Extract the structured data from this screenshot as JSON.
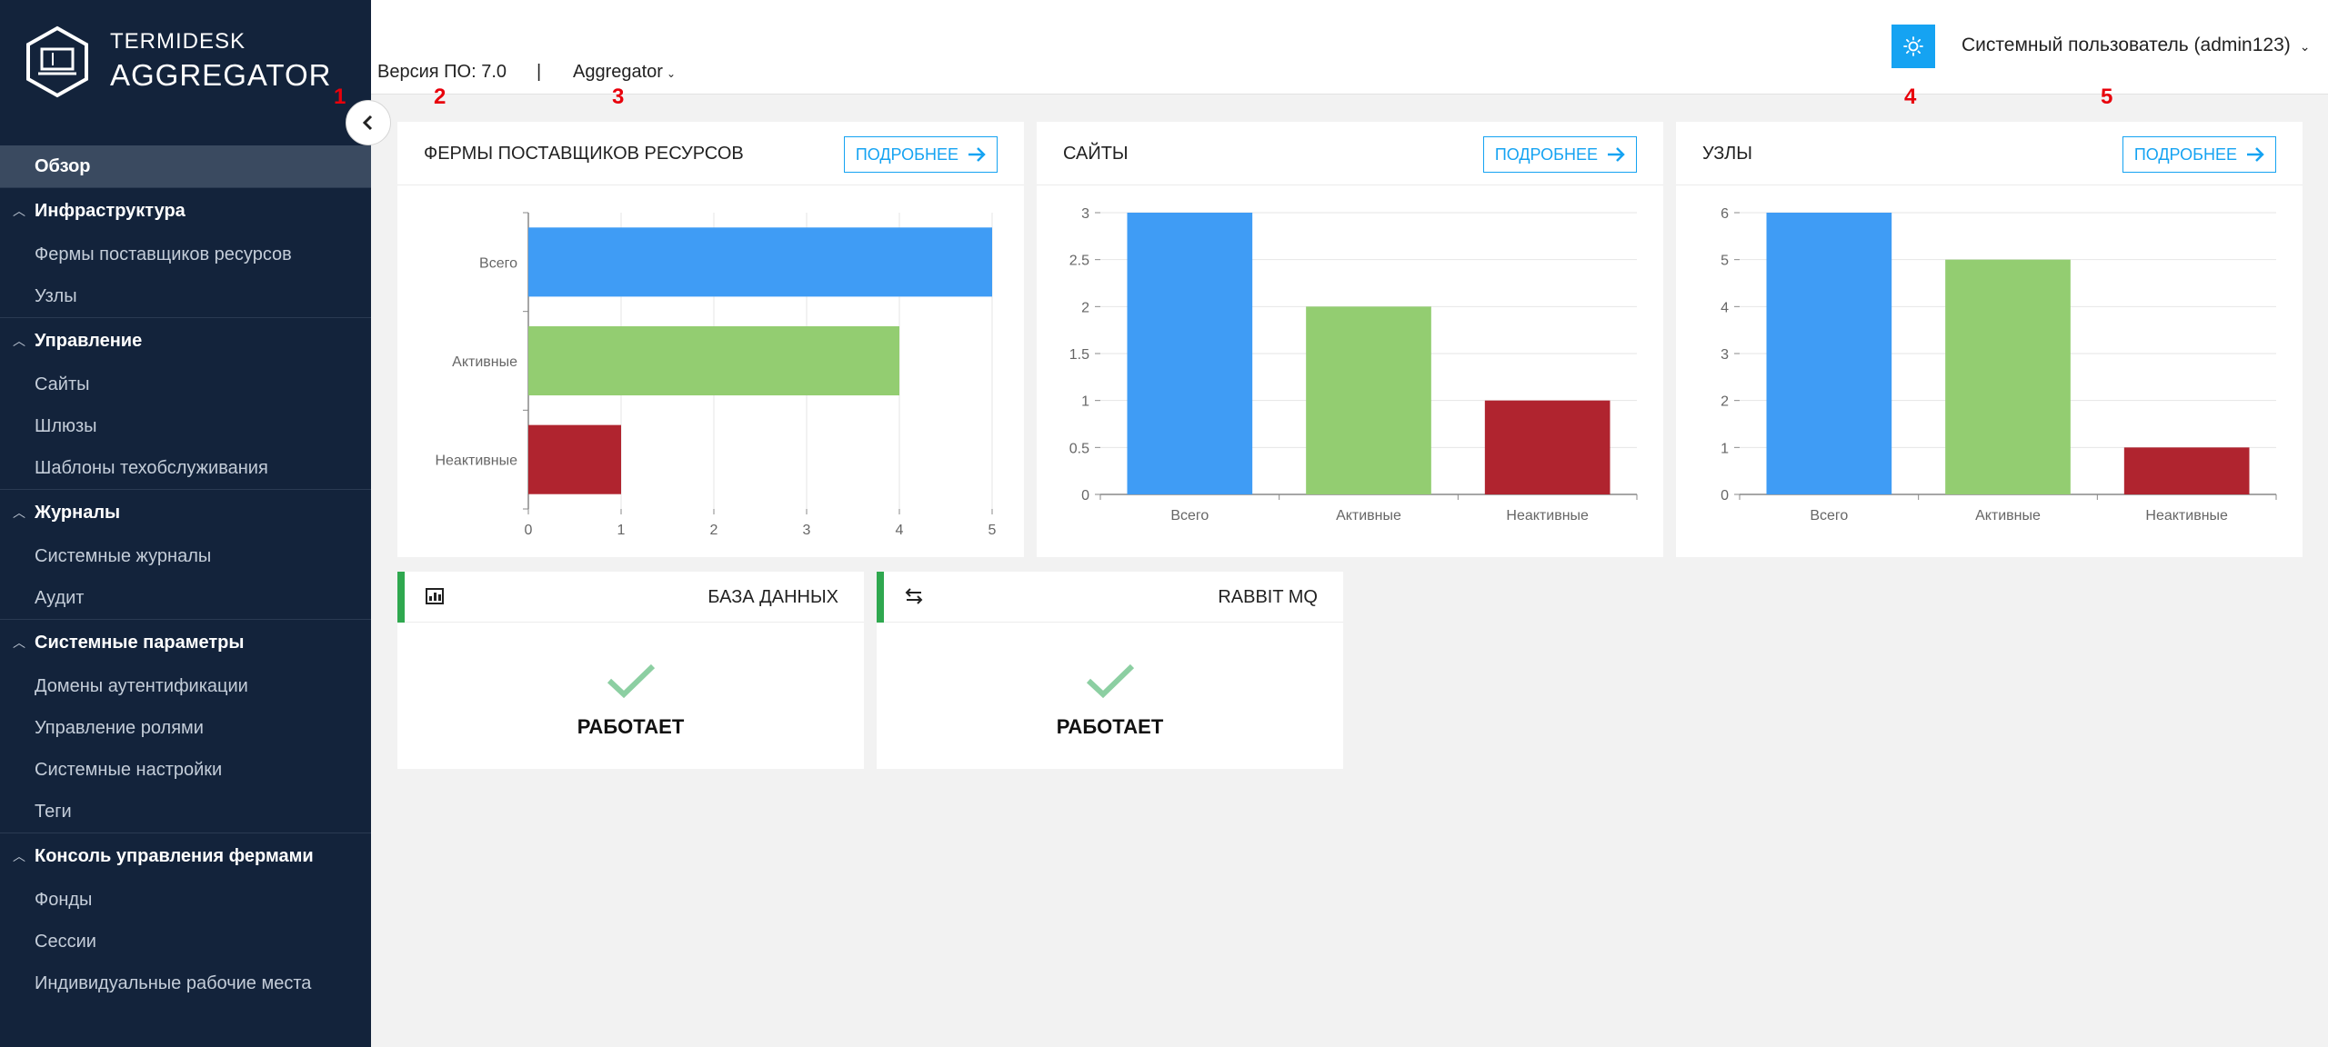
{
  "brand": {
    "top": "TERMIDESK",
    "main": "AGGREGATOR"
  },
  "sidebar": {
    "active": "Обзор",
    "groups": [
      {
        "title": "Инфраструктура",
        "items": [
          "Фермы поставщиков ресурсов",
          "Узлы"
        ]
      },
      {
        "title": "Управление",
        "items": [
          "Сайты",
          "Шлюзы",
          "Шаблоны техобслуживания"
        ]
      },
      {
        "title": "Журналы",
        "items": [
          "Системные журналы",
          "Аудит"
        ]
      },
      {
        "title": "Системные параметры",
        "items": [
          "Домены аутентификации",
          "Управление ролями",
          "Системные настройки",
          "Теги"
        ]
      },
      {
        "title": "Консоль управления фермами",
        "items": [
          "Фонды",
          "Сессии",
          "Индивидуальные рабочие места"
        ]
      }
    ]
  },
  "header": {
    "version": "Версия ПО: 7.0",
    "separator": "|",
    "context": "Aggregator",
    "user": "Системный пользователь (admin123)"
  },
  "markers": [
    "1",
    "2",
    "3",
    "4",
    "5"
  ],
  "more_label": "ПОДРОБНЕЕ",
  "colors": {
    "total": "#3f9cf5",
    "active": "#93cd71",
    "inactive": "#b0242f",
    "accent": "#15a3f2",
    "ok": "#2fa84f"
  },
  "cards": {
    "farms": {
      "title": "ФЕРМЫ ПОСТАВЩИКОВ РЕСУРСОВ"
    },
    "sites": {
      "title": "САЙТЫ"
    },
    "nodes": {
      "title": "УЗЛЫ"
    }
  },
  "chart_data": [
    {
      "type": "bar",
      "orientation": "horizontal",
      "categories": [
        "Всего",
        "Активные",
        "Неактивные"
      ],
      "values": [
        5,
        4,
        1
      ],
      "xlim": [
        0,
        5
      ],
      "ticks": [
        "0",
        "1",
        "2",
        "3",
        "4",
        "5"
      ],
      "grid": true
    },
    {
      "type": "bar",
      "categories": [
        "Всего",
        "Активные",
        "Неактивные"
      ],
      "values": [
        3,
        2,
        1
      ],
      "ylim": [
        0,
        3
      ],
      "ticks": [
        "0",
        "0.5",
        "1",
        "1.5",
        "2",
        "2.5",
        "3"
      ],
      "grid": true
    },
    {
      "type": "bar",
      "categories": [
        "Всего",
        "Активные",
        "Неактивные"
      ],
      "values": [
        6,
        5,
        1
      ],
      "ylim": [
        0,
        6
      ],
      "ticks": [
        "0",
        "1",
        "2",
        "3",
        "4",
        "5",
        "6"
      ],
      "grid": true
    }
  ],
  "status": {
    "db": {
      "title": "БАЗА ДАННЫХ",
      "text": "РАБОТАЕТ",
      "icon": "database-icon"
    },
    "mq": {
      "title": "RABBIT MQ",
      "text": "РАБОТАЕТ",
      "icon": "exchange-icon"
    }
  }
}
